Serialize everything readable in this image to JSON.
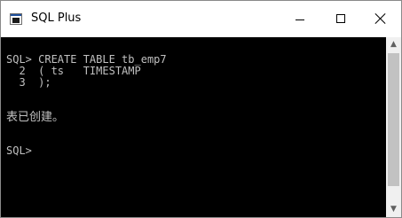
{
  "window": {
    "title": "SQL Plus",
    "icon": "console-app-icon"
  },
  "controls": {
    "minimize_icon": "minimize-icon",
    "maximize_icon": "maximize-icon",
    "close_icon": "close-icon"
  },
  "console": {
    "lines": [
      "SQL> CREATE TABLE tb_emp7",
      "  2  ( ts   TIMESTAMP",
      "  3  );",
      "",
      "表已创建。",
      "",
      "SQL>"
    ]
  },
  "scrollbar": {
    "up_arrow": "▲",
    "down_arrow": "▼"
  },
  "colors": {
    "console_background": "#000000",
    "console_text": "#c0c0c0",
    "titlebar_background": "#ffffff"
  }
}
